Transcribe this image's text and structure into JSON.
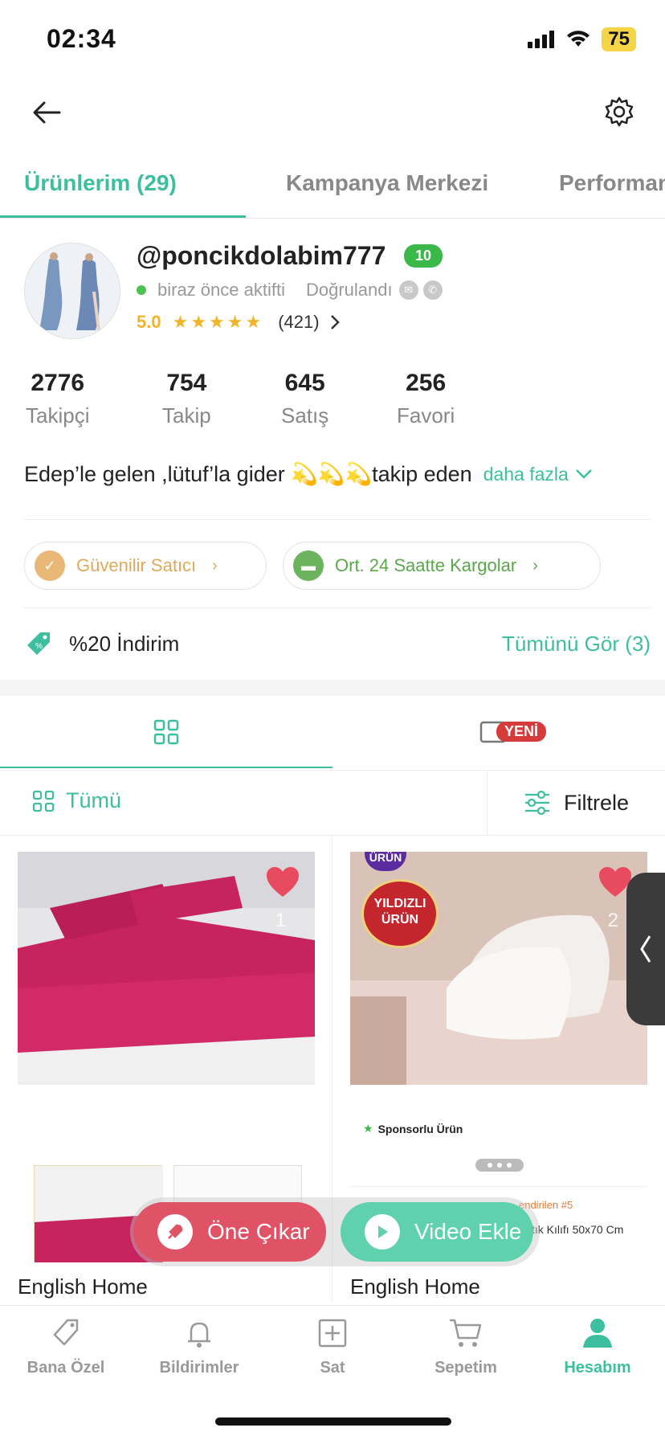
{
  "status_bar": {
    "time": "02:34",
    "battery": "75"
  },
  "tabs": [
    {
      "label": "Ürünlerim (29)",
      "active": true
    },
    {
      "label": "Kampanya Merkezi",
      "active": false
    },
    {
      "label": "Performans",
      "active": false
    }
  ],
  "profile": {
    "username": "@poncikdolabim777",
    "level": "10",
    "online_status": "biraz önce aktifti",
    "verified_label": "Doğrulandı",
    "rating": "5.0",
    "stars": "★★★★★",
    "rating_count": "(421)"
  },
  "stats": [
    {
      "value": "2776",
      "label": "Takipçi"
    },
    {
      "value": "754",
      "label": "Takip"
    },
    {
      "value": "645",
      "label": "Satış"
    },
    {
      "value": "256",
      "label": "Favori"
    }
  ],
  "bio": {
    "text": "Edep’le gelen ,lütuf’la gider 💫💫💫takip eden",
    "more": "daha fazla"
  },
  "badges": {
    "trusted": "Güvenilir Satıcı",
    "shipping": "Ort. 24 Saatte Kargolar"
  },
  "discount": {
    "label": "%20 İndirim",
    "see_all": "Tümünü Gör (3)"
  },
  "view_tabs": {
    "new_badge": "YENİ"
  },
  "filter": {
    "all": "Tümü",
    "filter": "Filtrele"
  },
  "products": [
    {
      "brand": "English Home",
      "index": "1"
    },
    {
      "brand": "English Home",
      "index": "2",
      "badge_top": "ÜRÜN",
      "badge_title": "YILDIZLI",
      "badge_sub": "ÜRÜN",
      "sponsored": "Sponsorlu Ürün",
      "rank_tag": "endirilen #5",
      "caption": "tık Kılıfı 50x70 Cm"
    }
  ],
  "actions": {
    "promote": "Öne Çıkar",
    "add_video": "Video Ekle"
  },
  "bottom_nav": [
    {
      "label": "Bana Özel",
      "active": false
    },
    {
      "label": "Bildirimler",
      "active": false
    },
    {
      "label": "Sat",
      "active": false
    },
    {
      "label": "Sepetim",
      "active": false
    },
    {
      "label": "Hesabım",
      "active": true
    }
  ],
  "colors": {
    "accent": "#3dbf9f",
    "promote": "#e05266",
    "video": "#5fd1ad",
    "star": "#f0b429"
  }
}
